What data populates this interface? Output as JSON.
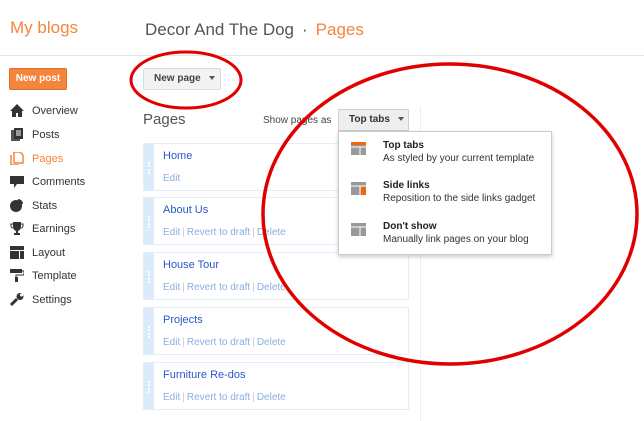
{
  "header": {
    "brand": "My blogs",
    "blog_title": "Decor And The Dog",
    "separator": "·",
    "section": "Pages"
  },
  "sidebar": {
    "new_post": "New post",
    "items": [
      {
        "label": "Overview",
        "icon": "home-icon"
      },
      {
        "label": "Posts",
        "icon": "posts-icon"
      },
      {
        "label": "Pages",
        "icon": "pages-icon",
        "active": true
      },
      {
        "label": "Comments",
        "icon": "comment-icon"
      },
      {
        "label": "Stats",
        "icon": "pie-chart-icon"
      },
      {
        "label": "Earnings",
        "icon": "trophy-icon"
      },
      {
        "label": "Layout",
        "icon": "layout-icon"
      },
      {
        "label": "Template",
        "icon": "paint-roller-icon"
      },
      {
        "label": "Settings",
        "icon": "wrench-icon"
      }
    ]
  },
  "main": {
    "new_page": "New page",
    "heading": "Pages",
    "show_as_label": "Show pages as",
    "show_as_value": "Top tabs",
    "actions": {
      "edit": "Edit",
      "revert": "Revert to draft",
      "delete": "Delete",
      "sep": "|"
    },
    "pages": [
      {
        "title": "Home"
      },
      {
        "title": "About Us"
      },
      {
        "title": "House Tour"
      },
      {
        "title": "Projects"
      },
      {
        "title": "Furniture Re-dos"
      }
    ]
  },
  "menu": [
    {
      "title": "Top tabs",
      "desc": "As styled by your current template"
    },
    {
      "title": "Side links",
      "desc": "Reposition to the side links gadget"
    },
    {
      "title": "Don't show",
      "desc": "Manually link pages on your blog"
    }
  ],
  "colors": {
    "accent": "#f5843c",
    "link": "#2a58c9",
    "annotation": "#e00000"
  }
}
